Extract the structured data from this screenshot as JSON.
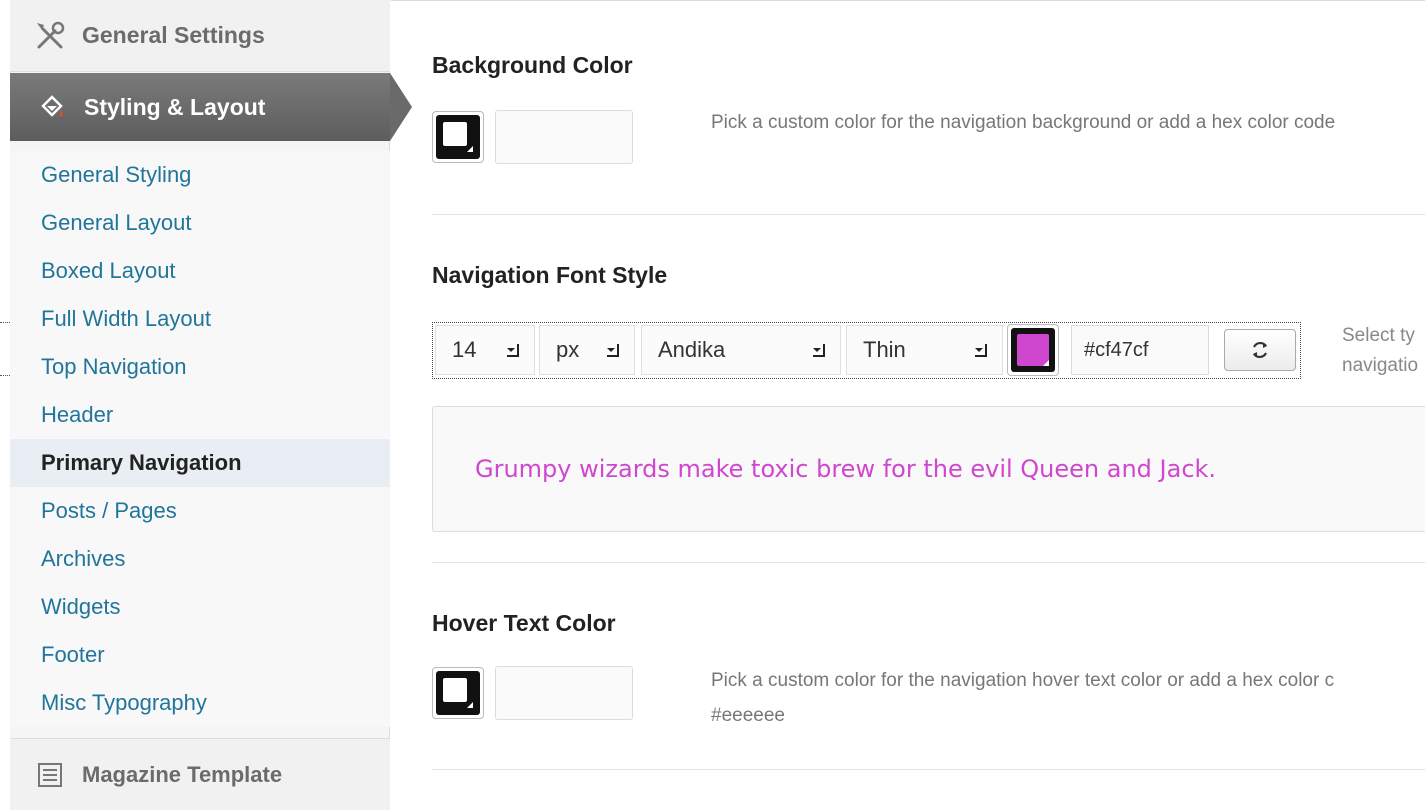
{
  "sidebar": {
    "general_settings": "General Settings",
    "styling_layout": "Styling & Layout",
    "items": [
      {
        "label": "General Styling"
      },
      {
        "label": "General Layout"
      },
      {
        "label": "Boxed Layout"
      },
      {
        "label": "Full Width Layout"
      },
      {
        "label": "Top Navigation"
      },
      {
        "label": "Header"
      },
      {
        "label": "Primary Navigation",
        "current": true
      },
      {
        "label": "Posts / Pages"
      },
      {
        "label": "Archives"
      },
      {
        "label": "Widgets"
      },
      {
        "label": "Footer"
      },
      {
        "label": "Misc Typography"
      }
    ],
    "magazine_template": "Magazine Template"
  },
  "background_color": {
    "title": "Background Color",
    "value": "",
    "description": "Pick a custom color for the navigation background or add a hex color code"
  },
  "font_style": {
    "title": "Navigation Font Style",
    "size": "14",
    "unit": "px",
    "family": "Andika",
    "weight": "Thin",
    "color_hex": "#cf47cf",
    "color": "#cf47cf",
    "description_line1": "Select ty",
    "description_line2": "navigatio",
    "preview_text": "Grumpy wizards make toxic brew for the evil Queen and Jack."
  },
  "hover_text_color": {
    "title": "Hover Text Color",
    "value": "",
    "description_line1": "Pick a custom color for the navigation hover text color or add a hex color c",
    "description_line2": "#eeeeee"
  }
}
